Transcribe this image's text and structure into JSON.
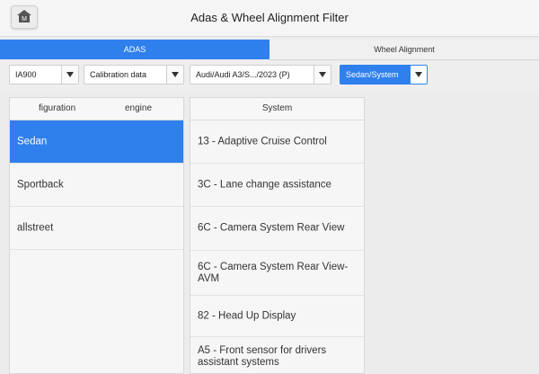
{
  "header": {
    "title": "Adas & Wheel Alignment Filter",
    "home_icon_letter": "M"
  },
  "tabs": [
    {
      "label": "ADAS",
      "active": true
    },
    {
      "label": "Wheel Alignment",
      "active": false
    }
  ],
  "filters": [
    {
      "label": "IA900",
      "selected": false
    },
    {
      "label": "Calibration data",
      "selected": false
    },
    {
      "label": "Audi/Audi A3/S.../2023 (P)",
      "selected": false
    },
    {
      "label": "Sedan/System",
      "selected": true
    }
  ],
  "left_panel": {
    "col1": "figuration",
    "col2": "engine",
    "items": [
      {
        "label": "Sedan",
        "selected": true
      },
      {
        "label": "Sportback",
        "selected": false
      },
      {
        "label": "allstreet",
        "selected": false
      }
    ]
  },
  "right_panel": {
    "header": "System",
    "items": [
      {
        "label": "13 - Adaptive Cruise Control"
      },
      {
        "label": "3C - Lane change assistance"
      },
      {
        "label": "6C - Camera System Rear View"
      },
      {
        "label": "6C - Camera System Rear View-AVM"
      },
      {
        "label": "82 - Head Up Display"
      },
      {
        "label": "A5 - Front sensor for drivers assistant systems"
      }
    ]
  },
  "colors": {
    "accent": "#2f80ed",
    "background": "#ececec"
  }
}
